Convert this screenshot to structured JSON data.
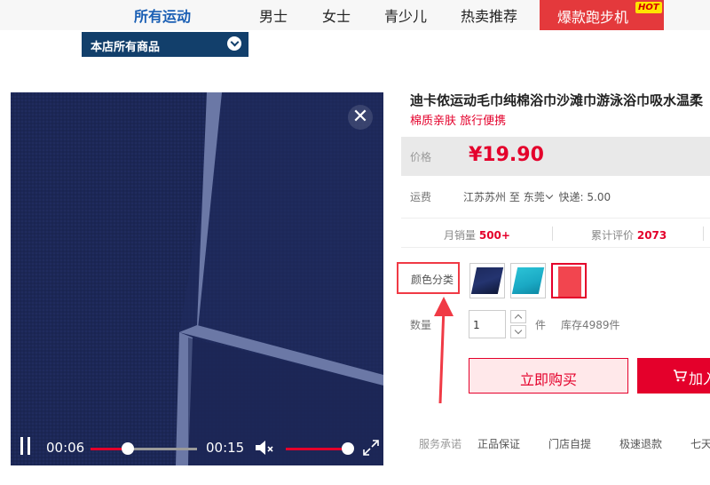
{
  "nav": {
    "items": [
      "所有运动",
      "男士",
      "女士",
      "青少儿",
      "热卖推荐"
    ],
    "hot_label": "爆款跑步机",
    "hot_badge": "HOT"
  },
  "store_dropdown": {
    "label": "本店所有商品",
    "icon": "chevron-down-circle-icon"
  },
  "video": {
    "current_time": "00:06",
    "duration": "00:15",
    "progress": 0.35,
    "volume": 1.0,
    "close_icon": "close-icon",
    "volume_icon": "mute-icon",
    "fullscreen_icon": "fullscreen-icon"
  },
  "product": {
    "title": "迪卡侬运动毛巾纯棉浴巾沙滩巾游泳浴巾吸水温柔",
    "subtitle": "棉质亲肤 旅行便携",
    "price_label": "价格",
    "price": "¥19.90",
    "shipping_label": "运费",
    "shipping_from": "江苏苏州",
    "shipping_to_prefix": "至",
    "shipping_to": "东莞",
    "shipping_fee": "快递: 5.00",
    "monthly_sales_label": "月销量",
    "monthly_sales": "500+",
    "reviews_label": "累计评价",
    "reviews": "2073",
    "color_label": "颜色分类",
    "swatches": [
      {
        "name": "navy",
        "color": "#1d2a5e",
        "selected": false
      },
      {
        "name": "teal",
        "color": "#2bc2d6",
        "selected": false
      },
      {
        "name": "red",
        "color": "#f2454f",
        "selected": true
      }
    ],
    "qty_label": "数量",
    "qty_value": "1",
    "unit": "件",
    "stock": "库存4989件",
    "buy_now": "立即购买",
    "add_cart": "加入",
    "promise_label": "服务承诺",
    "promises": [
      "正品保证",
      "门店自提",
      "极速退款",
      "七天"
    ]
  },
  "colors": {
    "accent": "#e4002b",
    "nav_active": "#1a5fb4",
    "store_bar": "#123f6b",
    "annotation": "#f03a45"
  }
}
